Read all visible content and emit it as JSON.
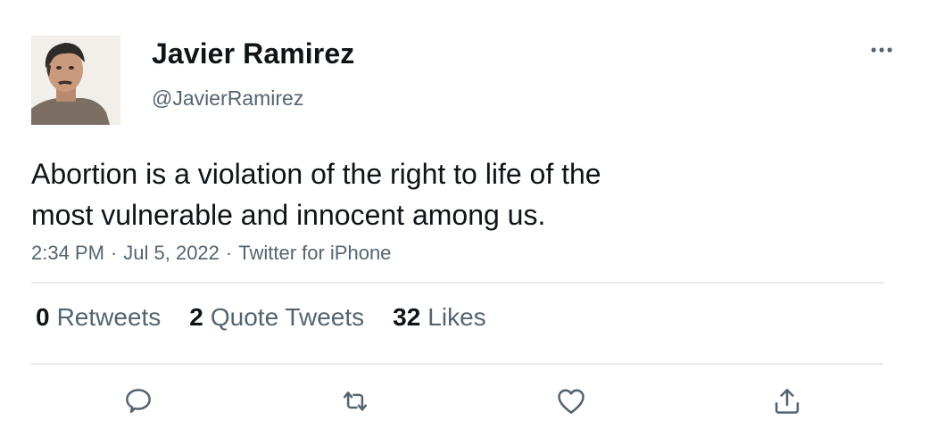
{
  "author": {
    "name": "Javier Ramirez",
    "handle": "@JavierRamirez"
  },
  "tweet": {
    "text_line1": "Abortion is a violation of the right to life of the",
    "text_line2": "most vulnerable and innocent among us.",
    "time": "2:34 PM",
    "date": "Jul 5, 2022",
    "source": "Twitter for iPhone",
    "separator": "·"
  },
  "stats": {
    "retweets_count": "0",
    "retweets_label": "Retweets",
    "quotes_count": "2",
    "quotes_label": "Quote Tweets",
    "likes_count": "32",
    "likes_label": "Likes"
  },
  "actions": {
    "reply_icon": "reply-icon",
    "retweet_icon": "retweet-icon",
    "like_icon": "heart-icon",
    "share_icon": "share-icon",
    "more_icon": "more-icon"
  },
  "colors": {
    "text": "#0f1419",
    "secondary": "#536471",
    "divider": "#e7e9ea"
  }
}
